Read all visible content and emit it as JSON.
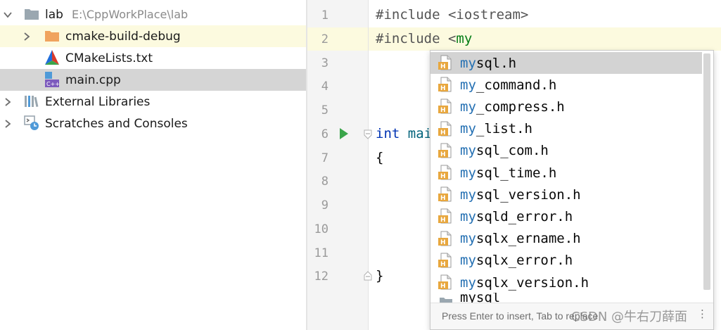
{
  "project_tree": {
    "items": [
      {
        "label": "lab",
        "path": "E:\\CppWorkPlace\\lab",
        "icon": "folder-icon",
        "expanded": true
      },
      {
        "label": "cmake-build-debug",
        "icon": "folder-orange-icon",
        "expanded": false
      },
      {
        "label": "CMakeLists.txt",
        "icon": "cmake-icon"
      },
      {
        "label": "main.cpp",
        "icon": "cpp-file-icon"
      },
      {
        "label": "External Libraries",
        "icon": "library-icon",
        "expanded": false
      },
      {
        "label": "Scratches and Consoles",
        "icon": "scratches-icon",
        "expanded": false
      }
    ]
  },
  "editor": {
    "line_numbers": [
      "1",
      "2",
      "3",
      "4",
      "5",
      "6",
      "7",
      "8",
      "9",
      "10",
      "11",
      "12"
    ],
    "current_line": "2",
    "code": {
      "line1": "#include <iostream>",
      "line2_prefix": "#include <",
      "line2_typed": "my",
      "line6_kw": "int",
      "line6_rest": " mai",
      "line7": "{",
      "line12": "}"
    }
  },
  "completion_popup": {
    "typed_prefix": "my",
    "items": [
      {
        "match": "my",
        "rest": "sql.h"
      },
      {
        "match": "my",
        "rest": "_command.h"
      },
      {
        "match": "my",
        "rest": "_compress.h"
      },
      {
        "match": "my",
        "rest": "_list.h"
      },
      {
        "match": "my",
        "rest": "sql_com.h"
      },
      {
        "match": "my",
        "rest": "sql_time.h"
      },
      {
        "match": "my",
        "rest": "sql_version.h"
      },
      {
        "match": "my",
        "rest": "sqld_error.h"
      },
      {
        "match": "my",
        "rest": "sqlx_ername.h"
      },
      {
        "match": "my",
        "rest": "sqlx_error.h"
      },
      {
        "match": "my",
        "rest": "sqlx_version.h"
      }
    ],
    "partial_item": "mysql",
    "hint": "Press Enter to insert, Tab to replace",
    "more_menu": "⋮"
  },
  "watermark": "CSDN @牛右刀薛面",
  "colors": {
    "current_line": "#fcfadf",
    "selection": "#d5d5d5",
    "match": "#2470b3",
    "keyword": "#0033b3",
    "string": "#067d17"
  }
}
